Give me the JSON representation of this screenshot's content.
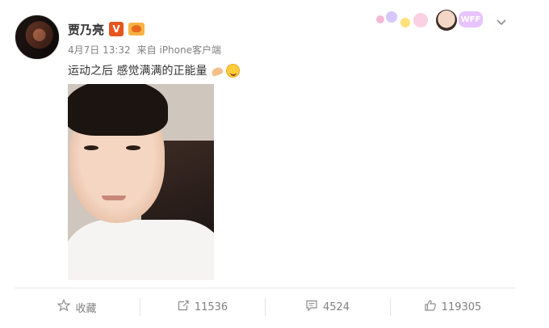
{
  "post": {
    "author_name": "贾乃亮",
    "verified_badge": "V",
    "level_icon": "crown-level-icon",
    "time": "4月7日 13:32",
    "source": "来自 iPhone客户端",
    "text": "运动之后 感觉满满的正能量",
    "emojis": [
      "muscle-emoji",
      "smile-emoji"
    ],
    "image_description_icon": "selfie-photo"
  },
  "banner": {
    "tag": "WFF"
  },
  "actions": {
    "favorite_label": "收藏",
    "repost_count": "11536",
    "comment_count": "4524",
    "like_count": "119305"
  },
  "colors": {
    "accent": "#e8541e",
    "meta_text": "#808080",
    "divider": "#e9e9e9"
  }
}
